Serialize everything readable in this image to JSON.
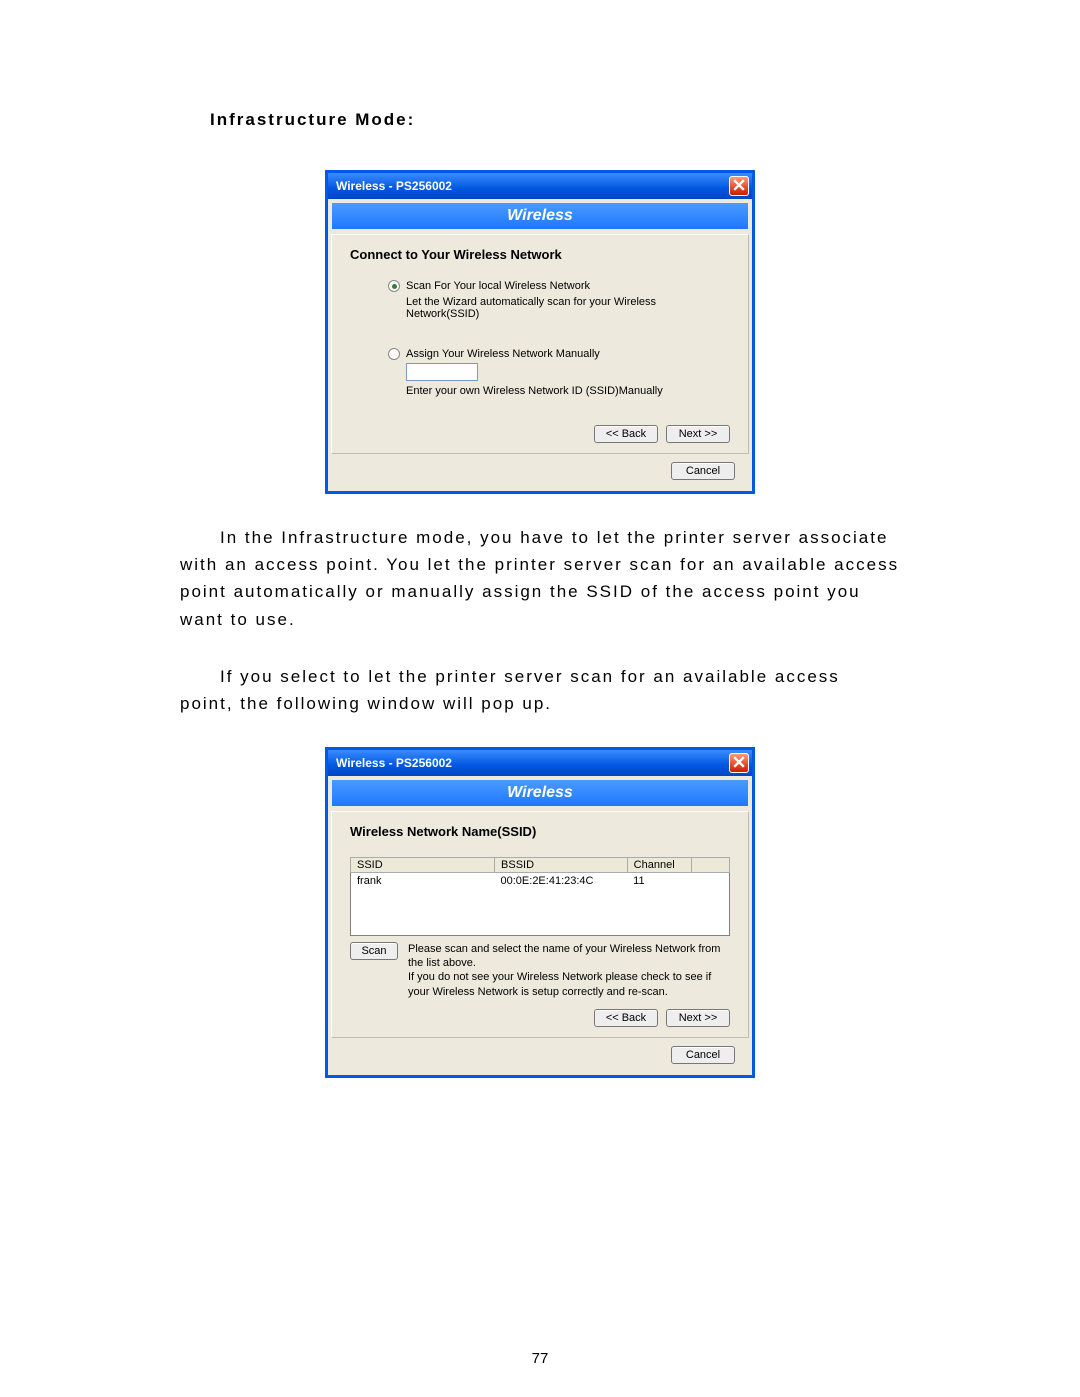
{
  "doc": {
    "section_title": "Infrastructure Mode:",
    "para1": "In the Infrastructure mode, you have to let the printer server associate with an access point. You let the printer server scan for an available access point automatically or manually assign the SSID of the access point you want to use.",
    "para2": "If you select to let the printer server scan for an available access point, the following window will pop up.",
    "page_number": "77"
  },
  "dialog1": {
    "title": "Wireless - PS256002",
    "banner": "Wireless",
    "panel_title": "Connect to Your Wireless Network",
    "opt_scan_label": "Scan For Your local Wireless Network",
    "opt_scan_desc": "Let the Wizard automatically scan for your Wireless Network(SSID)",
    "opt_manual_label": "Assign Your Wireless Network Manually",
    "opt_manual_desc": "Enter your own Wireless Network ID (SSID)Manually",
    "ssid_value": "",
    "btn_back": "<< Back",
    "btn_next": "Next >>",
    "btn_cancel": "Cancel"
  },
  "dialog2": {
    "title": "Wireless - PS256002",
    "banner": "Wireless",
    "panel_title": "Wireless Network Name(SSID)",
    "cols": {
      "ssid": "SSID",
      "bssid": "BSSID",
      "channel": "Channel"
    },
    "rows": [
      {
        "ssid": "frank",
        "bssid": "00:0E:2E:41:23:4C",
        "channel": "11"
      }
    ],
    "btn_scan": "Scan",
    "scan_msg": "Please scan and select the name of your Wireless Network from the list above.\nIf you do not see your Wireless Network please check to see if your Wireless Network is setup correctly and re-scan.",
    "btn_back": "<< Back",
    "btn_next": "Next >>",
    "btn_cancel": "Cancel"
  }
}
